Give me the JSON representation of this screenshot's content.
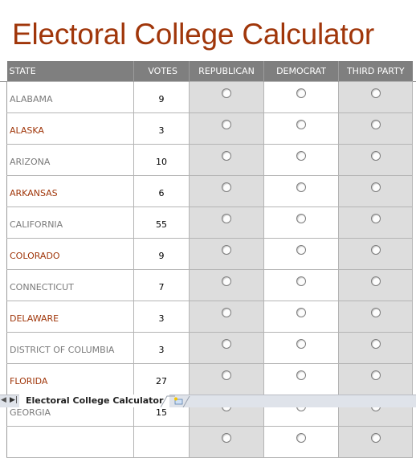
{
  "title": "Electoral College Calculator",
  "columns": {
    "state": "STATE",
    "votes": "VOTES",
    "republican": "REPUBLICAN",
    "democrat": "DEMOCRAT",
    "third_party": "THIRD PARTY"
  },
  "rows": [
    {
      "state": "ALABAMA",
      "votes": "9"
    },
    {
      "state": "ALASKA",
      "votes": "3"
    },
    {
      "state": "ARIZONA",
      "votes": "10"
    },
    {
      "state": "ARKANSAS",
      "votes": "6"
    },
    {
      "state": "CALIFORNIA",
      "votes": "55"
    },
    {
      "state": "COLORADO",
      "votes": "9"
    },
    {
      "state": "CONNECTICUT",
      "votes": "7"
    },
    {
      "state": "DELAWARE",
      "votes": "3"
    },
    {
      "state": "DISTRICT OF COLUMBIA",
      "votes": "3"
    },
    {
      "state": "FLORIDA",
      "votes": "27"
    },
    {
      "state": "GEORGIA",
      "votes": "15"
    },
    {
      "state": "",
      "votes": ""
    }
  ],
  "sheet_tabs": {
    "active": "Electoral College Calculator",
    "new_sheet_icon": "insert-worksheet-icon"
  },
  "colors": {
    "title": "#a0360a",
    "header_bg": "#7f7f7f",
    "shaded_column": "#dddddd",
    "alt_state_text": "#a0360a",
    "state_text": "#7a7a7a"
  }
}
